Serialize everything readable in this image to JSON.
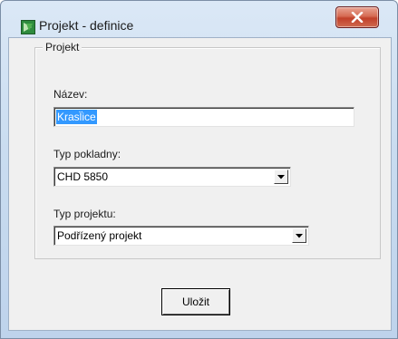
{
  "window": {
    "title": "Projekt - definice"
  },
  "group": {
    "legend": "Projekt",
    "name_label": "Název:",
    "name_value": "Krasl̈ice",
    "register_label": "Typ pokladny:",
    "register_value": "CHD 5850",
    "project_type_label": "Typ projektu:",
    "project_type_value": "Podřízený projekt"
  },
  "buttons": {
    "save_label": "Uložit"
  },
  "icons": {
    "app": "green-app-icon",
    "close": "close-icon",
    "dropdown": "chevron-down-icon"
  },
  "colors": {
    "selection": "#3399ff",
    "close_button": "#c1402a",
    "client_bg": "#f0f0f0"
  }
}
